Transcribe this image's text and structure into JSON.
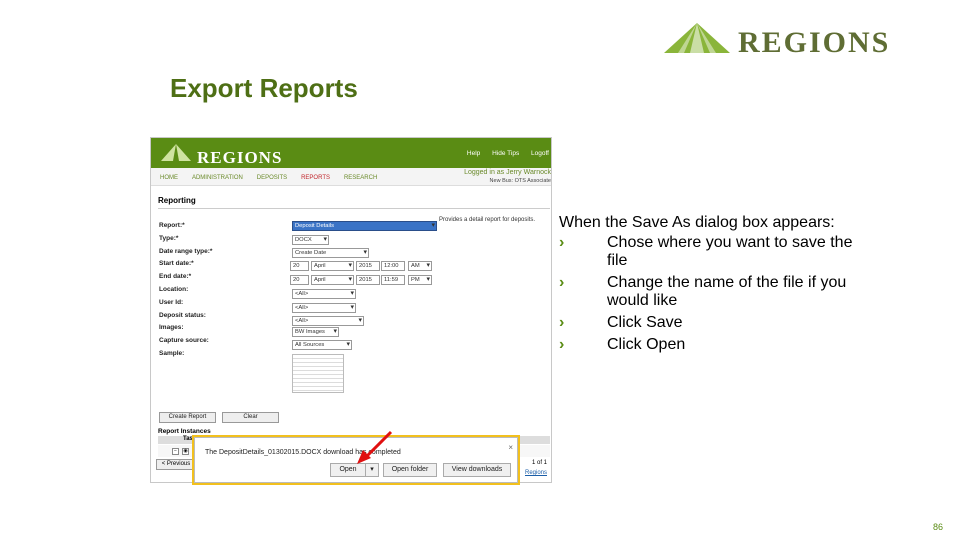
{
  "slide": {
    "brand": "Regions",
    "title": "Export Reports",
    "page_number": "86",
    "colors": {
      "accent": "#5a8c14",
      "title": "#4e6f15"
    }
  },
  "instructions": {
    "intro": "When the Save As dialog box appears:",
    "steps": [
      "Chose where you want to save the file",
      "Change the name of the file if you would like",
      "Click Save",
      "Click Open"
    ]
  },
  "app": {
    "brand": "Regions",
    "top_links": [
      "Help",
      "Hide Tips",
      "Logoff"
    ],
    "nav_tabs": [
      "HOME",
      "ADMINISTRATION",
      "DEPOSITS",
      "REPORTS",
      "RESEARCH"
    ],
    "active_tab": "REPORTS",
    "logged_in": "Logged in as Jerry Warnock",
    "role": "New Bus: OTS Associate",
    "section_title": "Reporting",
    "form": {
      "labels": [
        "Report:*",
        "Type:*",
        "Date range type:*",
        "Start date:*",
        "End date:*",
        "Location:",
        "User Id:",
        "Deposit status:",
        "Images:",
        "Capture source:",
        "Sample:"
      ],
      "report": "Deposit Details",
      "type": "DOCX",
      "date_range_type": "Create Date",
      "start": {
        "day": "20",
        "month": "April",
        "year": "2015",
        "time": "12:00",
        "ampm": "AM"
      },
      "end": {
        "day": "20",
        "month": "April",
        "year": "2015",
        "time": "11:59",
        "ampm": "PM"
      },
      "location": "<All>",
      "user_id": "<All>",
      "deposit_status": "<All>",
      "images": "BW Images",
      "capture_source": "All Sources",
      "hint": "Provides a detail report for deposits."
    },
    "buttons": {
      "create_report": "Create Report",
      "clear": "Clear"
    },
    "instances": {
      "title": "Report Instances",
      "header": "Tasks",
      "previous": "< Previous",
      "page_info": "1 of 1",
      "link": "Regions"
    },
    "download_bar": {
      "message": "The DepositDetails_01302015.DOCX download has completed",
      "open": "Open",
      "open_folder": "Open folder",
      "view_downloads": "View downloads",
      "close": "×"
    }
  }
}
